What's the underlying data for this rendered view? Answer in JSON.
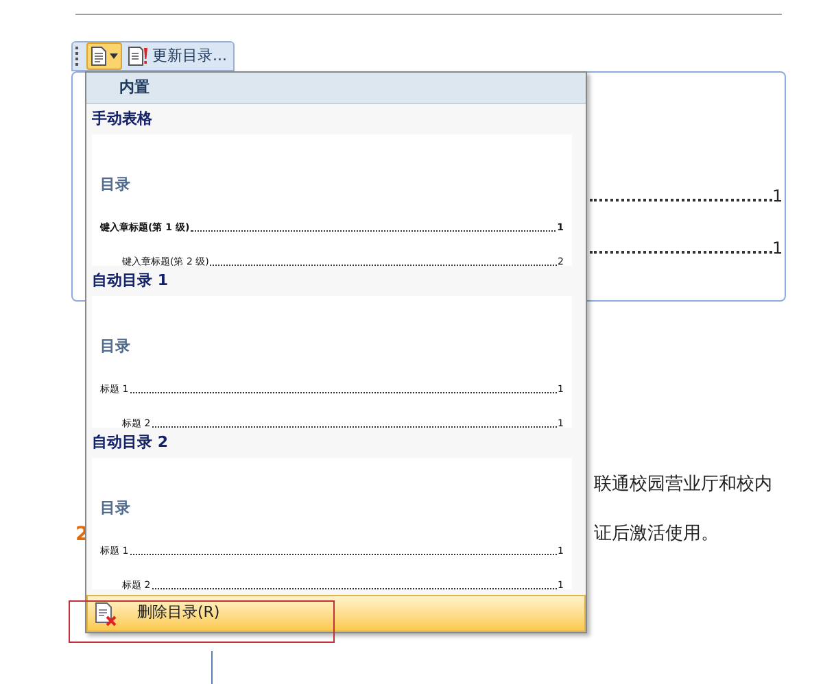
{
  "toolbar": {
    "buttons": [
      {
        "kind": "dropdown",
        "selected": true
      },
      {
        "kind": "text",
        "label": "更新目录...",
        "selected": false
      }
    ]
  },
  "document": {
    "toc_entries": [
      {
        "page": "1"
      },
      {
        "page": "1"
      }
    ],
    "paragraphs": [
      {
        "text": "联通校园营业厅和校内",
        "kind": "right"
      },
      {
        "text": "2",
        "kind": "heading"
      },
      {
        "text": "证后激活使用。",
        "kind": "right"
      }
    ]
  },
  "menu": {
    "header": "内置",
    "gallery": [
      {
        "title": "手动表格",
        "heading": "目录",
        "bold": true,
        "entries": [
          {
            "text": "键入章标题(第 1 级)",
            "page": "1",
            "children": [
              {
                "text": "键入章标题(第 2 级)",
                "page": "2"
              }
            ]
          }
        ]
      },
      {
        "title": "自动目录 1",
        "heading": "目录",
        "bold": false,
        "entries": [
          {
            "text": "标题 1",
            "page": "1",
            "children": [
              {
                "text": "标题 2",
                "page": "1"
              }
            ]
          }
        ]
      },
      {
        "title": "自动目录 2",
        "heading": "目录",
        "bold": false,
        "entries": [
          {
            "text": "标题 1",
            "page": "1",
            "children": [
              {
                "text": "标题 2",
                "page": "1"
              }
            ]
          }
        ]
      }
    ],
    "footer": {
      "label": "删除目录(R)",
      "highlighted": true
    }
  }
}
